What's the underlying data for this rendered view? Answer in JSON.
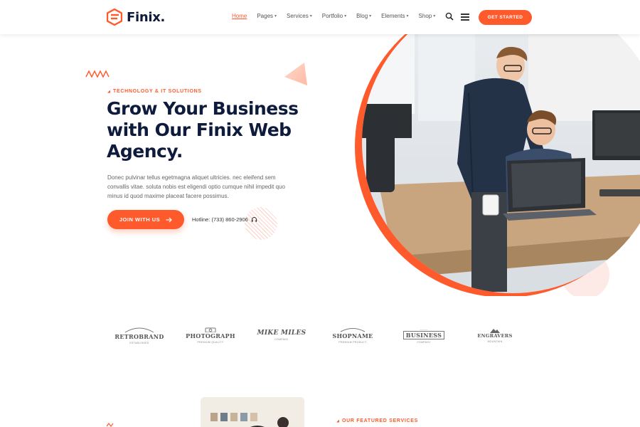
{
  "header": {
    "brand": "Finix.",
    "nav": [
      {
        "label": "Home",
        "active": true,
        "has_caret": false
      },
      {
        "label": "Pages",
        "active": false,
        "has_caret": true
      },
      {
        "label": "Services",
        "active": false,
        "has_caret": true
      },
      {
        "label": "Portfolio",
        "active": false,
        "has_caret": true
      },
      {
        "label": "Blog",
        "active": false,
        "has_caret": true
      },
      {
        "label": "Elements",
        "active": false,
        "has_caret": true
      },
      {
        "label": "Shop",
        "active": false,
        "has_caret": true
      }
    ],
    "cta_label": "GET STARTED",
    "icons": [
      "search-icon",
      "hamburger-menu-icon"
    ]
  },
  "hero": {
    "eyebrow": "TECHNOLOGY & IT SOLUTIONS",
    "title_line1": "Grow Your Business",
    "title_line2": "with Our Finix Web",
    "title_line3": "Agency.",
    "description": "Donec pulvinar tellus egetmagna aliquet ultricies. nec eleifend sem convallis vitae. soluta nobis est eligendi optio cumque nihil impedit quo minus id quod maxime placeat facere possimus.",
    "join_label": "JOIN WITH US",
    "hotline": "Hotline: (733) 860-2906"
  },
  "brands": [
    {
      "name": "RETROBRAND",
      "sub": "ESTABLISHED"
    },
    {
      "name": "PHOTOGRAPH",
      "sub": "PREMIUM QUALITY"
    },
    {
      "name": "MIKE MILES",
      "sub": "COMPANY"
    },
    {
      "name": "SHOPNAME",
      "sub": "PREMIUM PRODUCT"
    },
    {
      "name": "BUSINESS",
      "sub": "COMPANY"
    },
    {
      "name": "ENGRAVERS",
      "sub": "MOUNTAIN"
    }
  ],
  "featured": {
    "eyebrow": "OUR FEATURED SERVICES"
  },
  "colors": {
    "accent": "#ff5a2c",
    "navy": "#0e1b3d"
  }
}
